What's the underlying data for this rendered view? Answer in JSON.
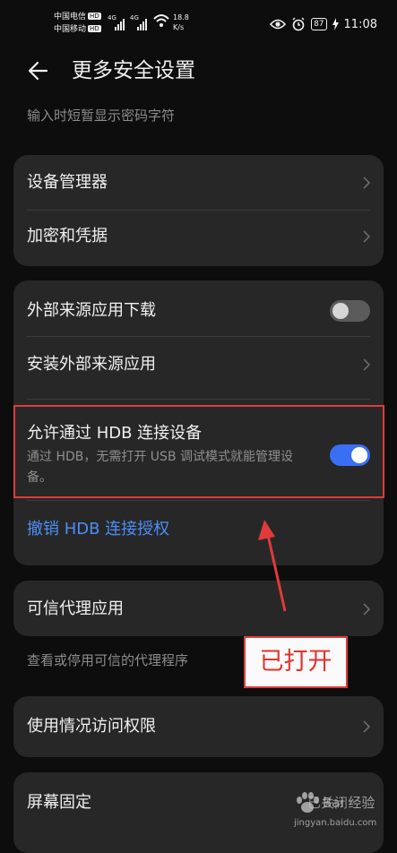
{
  "status_bar": {
    "carrier_1": "中国电信",
    "carrier_2": "中国移动",
    "hd_badge": "HD",
    "net_tag": "4G",
    "net_speed_value": "18.8",
    "net_speed_unit": "K/s",
    "battery": "87",
    "time": "11:08",
    "icons": [
      "wifi-icon",
      "eye-icon",
      "alarm-icon",
      "battery-icon",
      "charging-icon"
    ]
  },
  "header": {
    "title": "更多安全设置",
    "back_icon": "arrow-left-icon"
  },
  "hint_top": "输入时短暂显示密码字符",
  "group1": {
    "items": [
      {
        "label": "设备管理器"
      },
      {
        "label": "加密和凭据"
      }
    ]
  },
  "group2": {
    "external_download": {
      "label": "外部来源应用下载",
      "enabled": false
    },
    "install_external": {
      "label": "安装外部来源应用"
    },
    "hdb": {
      "label": "允许通过 HDB 连接设备",
      "description": "通过 HDB，无需打开 USB 调试模式就能管理设备。",
      "enabled": true
    },
    "revoke": {
      "label": "撤销 HDB 连接授权"
    }
  },
  "trusted_agents": {
    "label": "可信代理应用",
    "hint": "查看或停用可信的代理程序"
  },
  "usage_access": {
    "label": "使用情况访问权限"
  },
  "screen_pinning": {
    "label": "屏幕固定",
    "status": "已关闭"
  },
  "annotation": {
    "callout_text": "已打开",
    "color": "#e03a3a"
  },
  "watermark": {
    "text": "Bai 经验",
    "url": "jingyan.baidu.com"
  },
  "colors": {
    "accent": "#3a6ff5",
    "link": "#4d8df5",
    "card": "#272727",
    "background": "#0d0d0d"
  }
}
